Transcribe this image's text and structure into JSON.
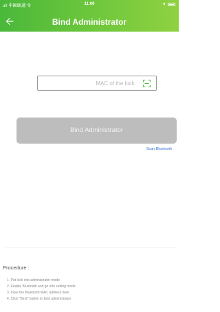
{
  "status_bar": {
    "carrier": "ull 中国联通 令",
    "time": "11:00",
    "icons": [
      "signal-icon",
      "wifi-icon",
      "location-icon",
      "battery-icon"
    ]
  },
  "header": {
    "back_icon": "arrow-left-icon",
    "title": "Bind Administrator",
    "background": "#5fc03a"
  },
  "mac_input": {
    "value": "",
    "placeholder": "MAC of the lock.",
    "icon": "scan-frame-icon"
  },
  "bind_button": {
    "label": "Bind Administrator",
    "color": "#bdbdbd"
  },
  "scan_bluetooth": {
    "label": "Scan Bluetooth",
    "color": "#2a6cd6"
  },
  "procedure": {
    "title": "Procedure :",
    "steps": [
      "1. Put lock into administrator mode",
      "2. Enable Bluetooth and go into setting mode",
      "3. Input the Bluetooth MAC address here",
      "4. Click \"Bind\" button to bind administrator"
    ]
  }
}
